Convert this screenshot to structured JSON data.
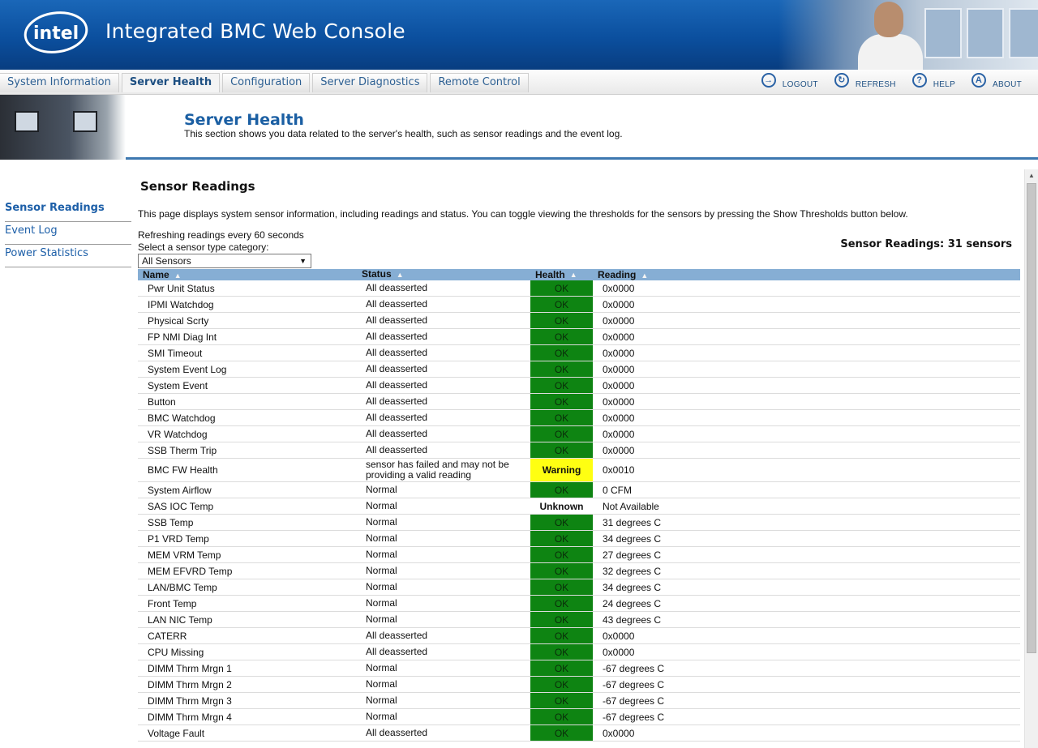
{
  "app": {
    "title": "Integrated BMC Web Console",
    "logo_text": "intel"
  },
  "nav": {
    "tabs": [
      {
        "label": "System Information",
        "active": false
      },
      {
        "label": "Server Health",
        "active": true
      },
      {
        "label": "Configuration",
        "active": false
      },
      {
        "label": "Server Diagnostics",
        "active": false
      },
      {
        "label": "Remote Control",
        "active": false
      }
    ],
    "links": [
      {
        "label": "LOGOUT",
        "icon": "logout-icon"
      },
      {
        "label": "REFRESH",
        "icon": "refresh-icon"
      },
      {
        "label": "HELP",
        "icon": "help-icon"
      },
      {
        "label": "ABOUT",
        "icon": "about-icon"
      }
    ]
  },
  "page": {
    "title": "Server Health",
    "description": "This section shows you data related to the server's health, such as sensor readings and the event log."
  },
  "sidebar": {
    "items": [
      {
        "label": "Sensor Readings",
        "active": true
      },
      {
        "label": "Event Log",
        "active": false
      },
      {
        "label": "Power Statistics",
        "active": false
      }
    ]
  },
  "content": {
    "title": "Sensor Readings",
    "intro": "This page displays system sensor information, including readings and status. You can toggle viewing the thresholds for the sensors by pressing the Show Thresholds button below.",
    "refresh_text": "Refreshing readings every 60 seconds",
    "category_label": "Select a sensor type category:",
    "category_value": "All Sensors",
    "count_text": "Sensor Readings: 31 sensors"
  },
  "table": {
    "headers": {
      "name": "Name",
      "status": "Status",
      "health": "Health",
      "reading": "Reading"
    },
    "rows": [
      {
        "name": "Pwr Unit Status",
        "status": "All deasserted",
        "health": "OK",
        "reading": "0x0000"
      },
      {
        "name": "IPMI Watchdog",
        "status": "All deasserted",
        "health": "OK",
        "reading": "0x0000"
      },
      {
        "name": "Physical Scrty",
        "status": "All deasserted",
        "health": "OK",
        "reading": "0x0000"
      },
      {
        "name": "FP NMI Diag Int",
        "status": "All deasserted",
        "health": "OK",
        "reading": "0x0000"
      },
      {
        "name": "SMI Timeout",
        "status": "All deasserted",
        "health": "OK",
        "reading": "0x0000"
      },
      {
        "name": "System Event Log",
        "status": "All deasserted",
        "health": "OK",
        "reading": "0x0000"
      },
      {
        "name": "System Event",
        "status": "All deasserted",
        "health": "OK",
        "reading": "0x0000"
      },
      {
        "name": "Button",
        "status": "All deasserted",
        "health": "OK",
        "reading": "0x0000"
      },
      {
        "name": "BMC Watchdog",
        "status": "All deasserted",
        "health": "OK",
        "reading": "0x0000"
      },
      {
        "name": "VR Watchdog",
        "status": "All deasserted",
        "health": "OK",
        "reading": "0x0000"
      },
      {
        "name": "SSB Therm Trip",
        "status": "All deasserted",
        "health": "OK",
        "reading": "0x0000"
      },
      {
        "name": "BMC FW Health",
        "status": "sensor has failed and may not be providing a valid reading",
        "health": "Warning",
        "reading": "0x0010"
      },
      {
        "name": "System Airflow",
        "status": "Normal",
        "health": "OK",
        "reading": "0 CFM"
      },
      {
        "name": "SAS IOC Temp",
        "status": "Normal",
        "health": "Unknown",
        "reading": "Not Available"
      },
      {
        "name": "SSB Temp",
        "status": "Normal",
        "health": "OK",
        "reading": "31 degrees C"
      },
      {
        "name": "P1 VRD Temp",
        "status": "Normal",
        "health": "OK",
        "reading": "34 degrees C"
      },
      {
        "name": "MEM VRM Temp",
        "status": "Normal",
        "health": "OK",
        "reading": "27 degrees C"
      },
      {
        "name": "MEM EFVRD Temp",
        "status": "Normal",
        "health": "OK",
        "reading": "32 degrees C"
      },
      {
        "name": "LAN/BMC Temp",
        "status": "Normal",
        "health": "OK",
        "reading": "34 degrees C"
      },
      {
        "name": "Front Temp",
        "status": "Normal",
        "health": "OK",
        "reading": "24 degrees C"
      },
      {
        "name": "LAN NIC Temp",
        "status": "Normal",
        "health": "OK",
        "reading": "43 degrees C"
      },
      {
        "name": "CATERR",
        "status": "All deasserted",
        "health": "OK",
        "reading": "0x0000"
      },
      {
        "name": "CPU Missing",
        "status": "All deasserted",
        "health": "OK",
        "reading": "0x0000"
      },
      {
        "name": "DIMM Thrm Mrgn 1",
        "status": "Normal",
        "health": "OK",
        "reading": "-67 degrees C"
      },
      {
        "name": "DIMM Thrm Mrgn 2",
        "status": "Normal",
        "health": "OK",
        "reading": "-67 degrees C"
      },
      {
        "name": "DIMM Thrm Mrgn 3",
        "status": "Normal",
        "health": "OK",
        "reading": "-67 degrees C"
      },
      {
        "name": "DIMM Thrm Mrgn 4",
        "status": "Normal",
        "health": "OK",
        "reading": "-67 degrees C"
      },
      {
        "name": "Voltage Fault",
        "status": "All deasserted",
        "health": "OK",
        "reading": "0x0000"
      }
    ]
  },
  "colors": {
    "ok": "#0e8412",
    "warning": "#ffff12",
    "header_bg": "#86aed4",
    "accent": "#1b5fa3"
  }
}
